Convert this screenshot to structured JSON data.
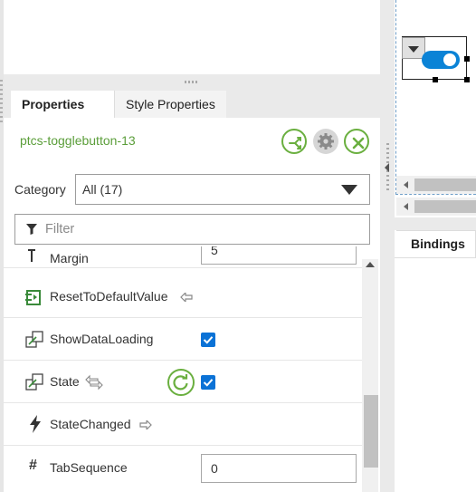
{
  "tabs": {
    "properties": "Properties",
    "style_properties": "Style Properties"
  },
  "widget": {
    "name": "ptcs-togglebutton-13"
  },
  "category": {
    "label": "Category",
    "value": "All (17)"
  },
  "filter": {
    "placeholder": "Filter"
  },
  "properties": [
    {
      "name": "Margin",
      "icon": "margin-icon",
      "value": "5"
    },
    {
      "name": "ResetToDefaultValue",
      "icon": "service-icon",
      "suffix_icon": "arrow-left-icon"
    },
    {
      "name": "ShowDataLoading",
      "icon": "bindable-icon",
      "checked": true
    },
    {
      "name": "State",
      "icon": "bindable-icon",
      "suffix_icon": "bidirectional-arrows-icon",
      "checked": true,
      "has_reset": true
    },
    {
      "name": "StateChanged",
      "icon": "event-icon",
      "suffix_icon": "arrow-right-icon"
    },
    {
      "name": "TabSequence",
      "icon": "hash-icon",
      "value": "0"
    }
  ],
  "right_panel": {
    "bindings_tab": "Bindings"
  },
  "colors": {
    "accent_green": "#6aaf3f",
    "checkbox_blue": "#0b72d6",
    "toggle_blue": "#0b83d6",
    "name_green": "#5b9e3a"
  }
}
